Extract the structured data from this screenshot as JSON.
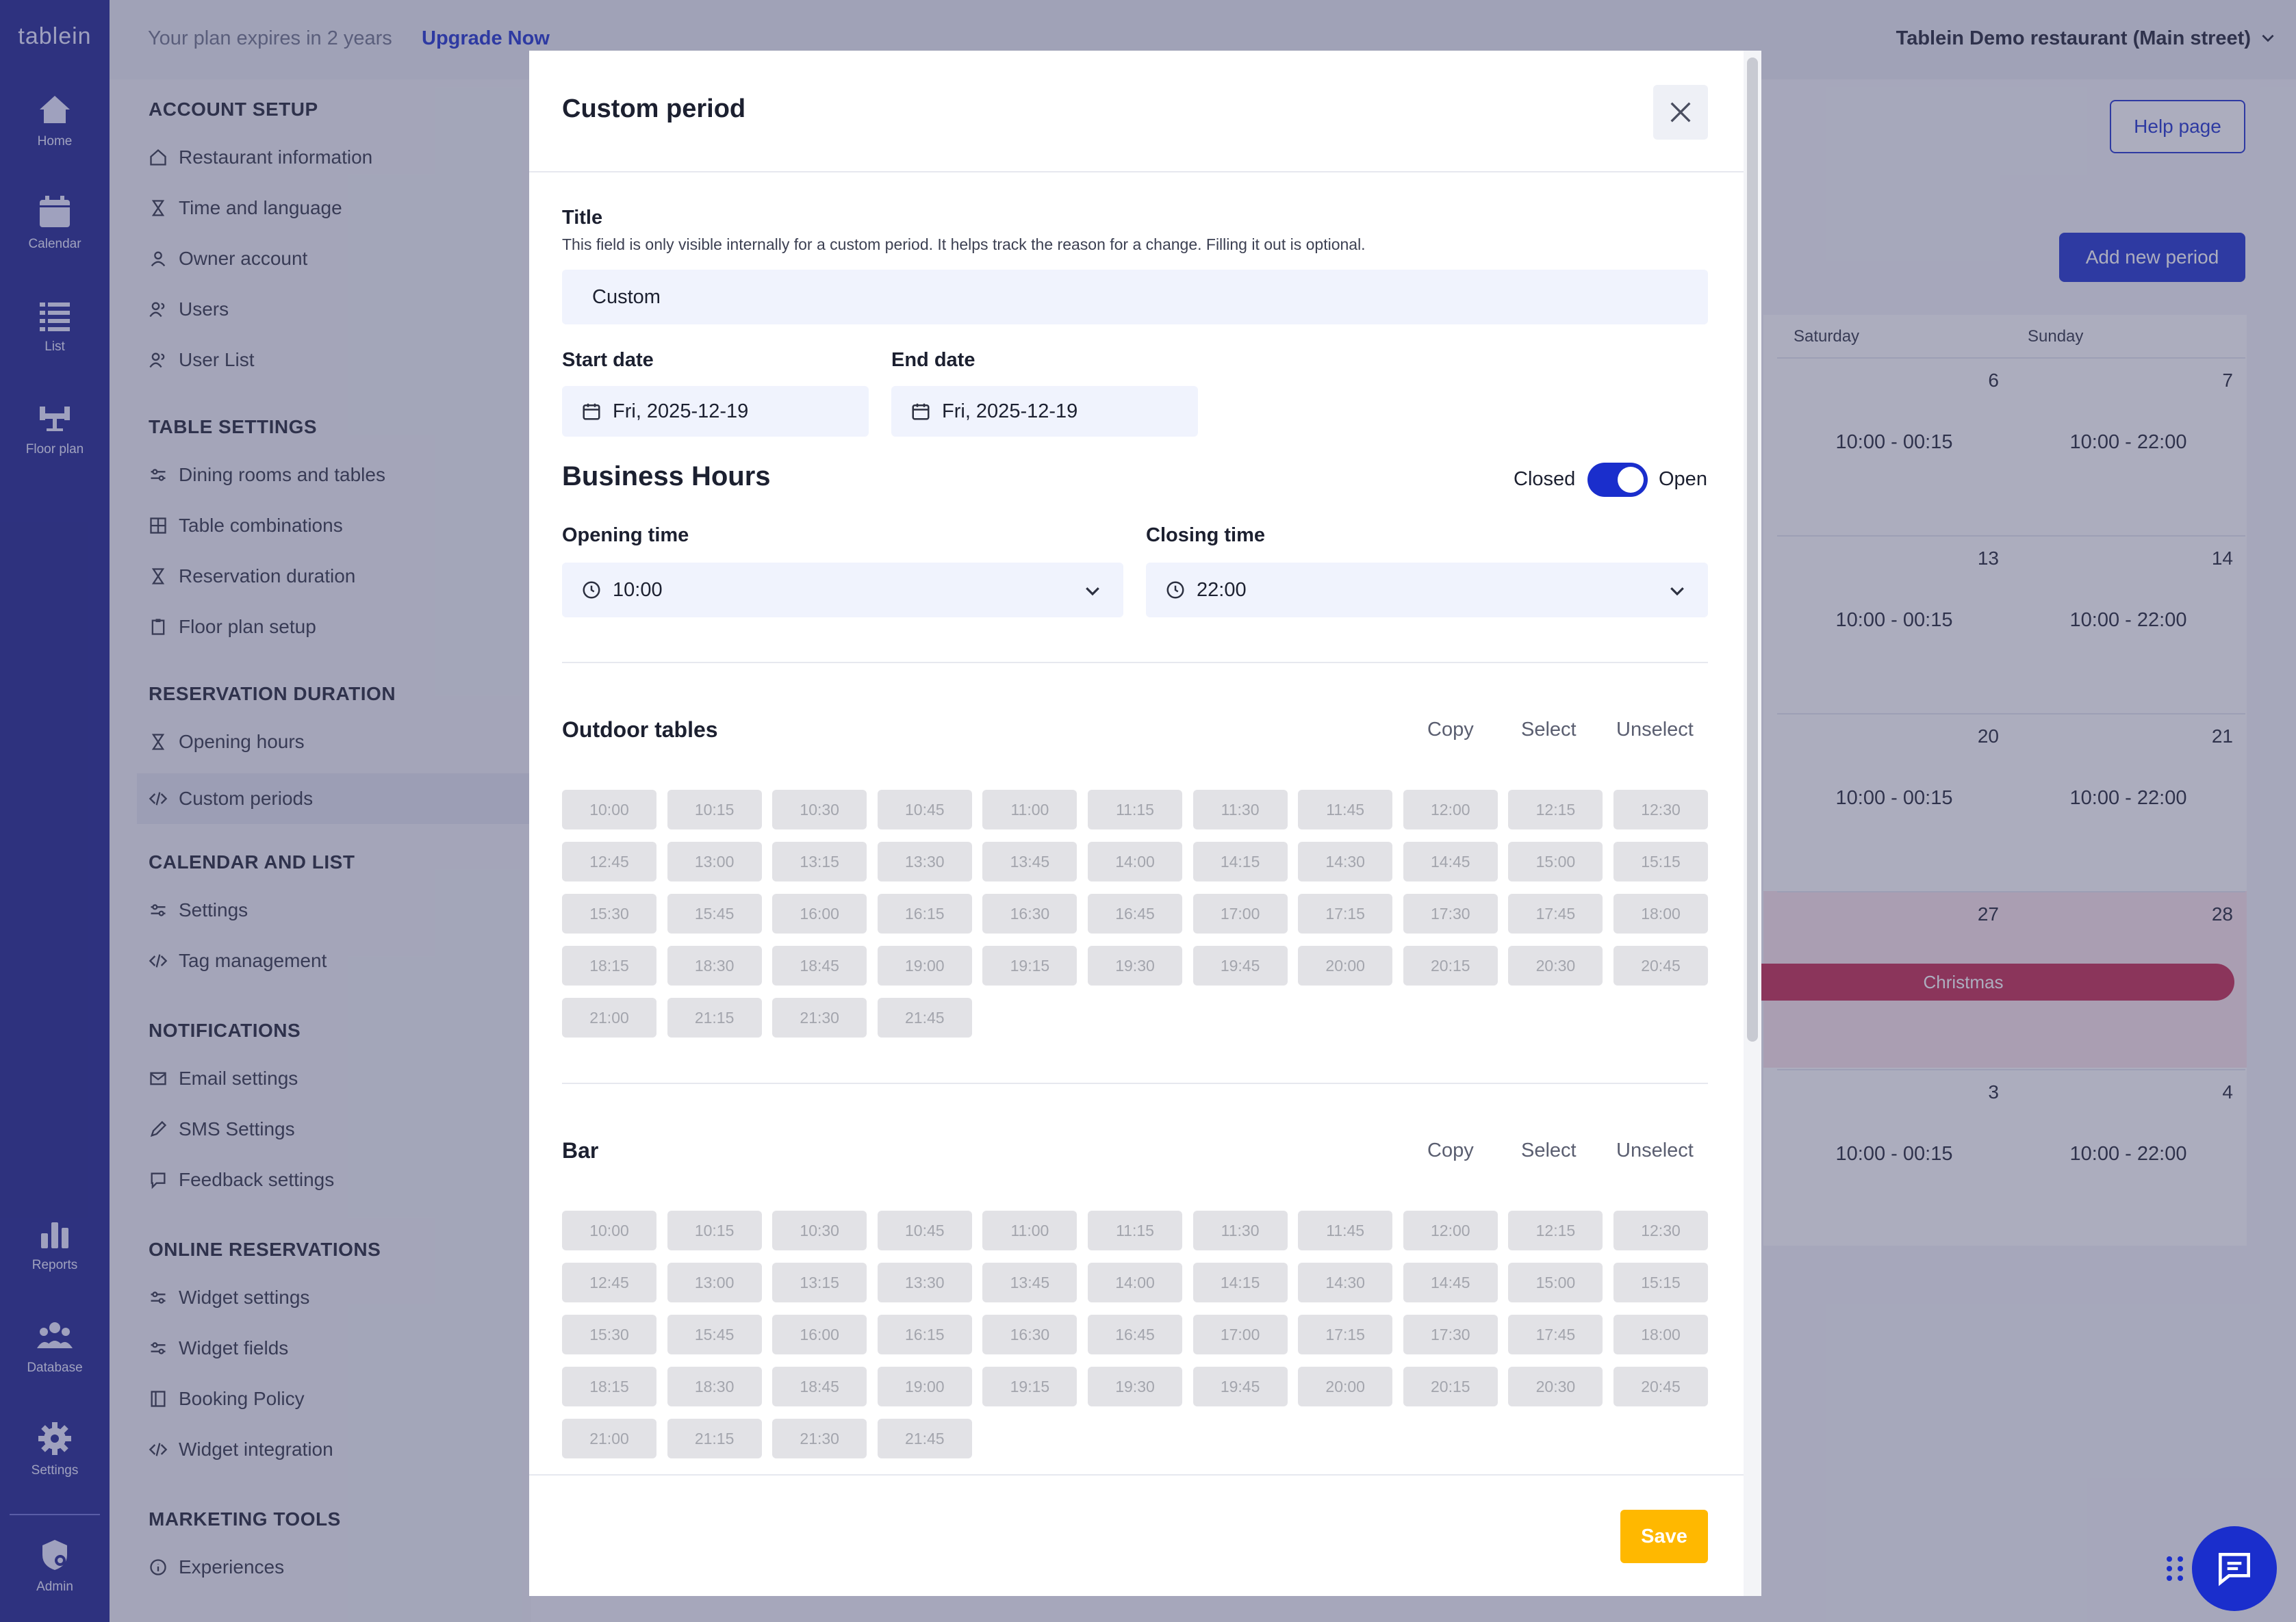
{
  "app": {
    "logo": "tablein"
  },
  "rail": {
    "top": [
      {
        "label": "Home",
        "icon": "home-icon"
      },
      {
        "label": "Calendar",
        "icon": "calendar-icon"
      },
      {
        "label": "List",
        "icon": "list-icon"
      },
      {
        "label": "Floor plan",
        "icon": "floor-plan-icon"
      }
    ],
    "bottom": [
      {
        "label": "Reports",
        "icon": "bar-chart-icon"
      },
      {
        "label": "Database",
        "icon": "users-group-icon"
      },
      {
        "label": "Settings",
        "icon": "gear-icon"
      },
      {
        "label": "Admin",
        "icon": "shield-gear-icon"
      }
    ]
  },
  "topbar": {
    "plan_text": "Your plan expires in 2 years",
    "upgrade_label": "Upgrade Now",
    "restaurant": "Tablein Demo restaurant (Main street)"
  },
  "menu": {
    "sections": [
      {
        "title": "ACCOUNT SETUP",
        "items": [
          "Restaurant information",
          "Time and language",
          "Owner account",
          "Users",
          "User List"
        ]
      },
      {
        "title": "TABLE SETTINGS",
        "items": [
          "Dining rooms and tables",
          "Table combinations",
          "Reservation duration",
          "Floor plan setup"
        ]
      },
      {
        "title": "RESERVATION DURATION",
        "items": [
          "Opening hours",
          "Custom periods"
        ]
      },
      {
        "title": "CALENDAR AND LIST",
        "items": [
          "Settings",
          "Tag management"
        ]
      },
      {
        "title": "NOTIFICATIONS",
        "items": [
          "Email settings",
          "SMS Settings",
          "Feedback settings"
        ]
      },
      {
        "title": "ONLINE RESERVATIONS",
        "items": [
          "Widget settings",
          "Widget fields",
          "Booking Policy",
          "Widget integration"
        ]
      },
      {
        "title": "MARKETING TOOLS",
        "items": [
          "Experiences"
        ]
      }
    ],
    "active_item": "Custom periods"
  },
  "content": {
    "help_label": "Help page",
    "add_label": "Add new period",
    "cal_headers": [
      "Saturday",
      "Sunday"
    ],
    "cal_rows": [
      {
        "sat_day": "6",
        "sun_day": "7",
        "sat_hours": "10:00 - 00:15",
        "sun_hours": "10:00 - 22:00"
      },
      {
        "sat_day": "13",
        "sun_day": "14",
        "sat_hours": "10:00 - 00:15",
        "sun_hours": "10:00 - 22:00"
      },
      {
        "sat_day": "20",
        "sun_day": "21",
        "sat_hours": "10:00 - 00:15",
        "sun_hours": "10:00 - 22:00"
      },
      {
        "sat_day": "27",
        "sun_day": "28",
        "sat_hours": "",
        "sun_hours": ""
      },
      {
        "sat_day": "3",
        "sun_day": "4",
        "sat_hours": "10:00 - 00:15",
        "sun_hours": "10:00 - 22:00"
      }
    ],
    "event_label": "Christmas"
  },
  "modal": {
    "title": "Custom period",
    "title_label": "Title",
    "title_help": "This field is only visible internally for a custom period. It helps track the reason for a change. Filling it out is optional.",
    "title_value": "Custom",
    "start_label": "Start date",
    "start_value": "Fri, 2025-12-19",
    "end_label": "End date",
    "end_value": "Fri, 2025-12-19",
    "business_hours": "Business Hours",
    "closed_label": "Closed",
    "open_label": "Open",
    "toggle_on": true,
    "opening_label": "Opening time",
    "opening_value": "10:00",
    "closing_label": "Closing time",
    "closing_value": "22:00",
    "sections": [
      {
        "name": "Outdoor tables",
        "copy": "Copy",
        "select": "Select",
        "unselect": "Unselect"
      },
      {
        "name": "Bar",
        "copy": "Copy",
        "select": "Select",
        "unselect": "Unselect"
      }
    ],
    "slots": [
      "10:00",
      "10:15",
      "10:30",
      "10:45",
      "11:00",
      "11:15",
      "11:30",
      "11:45",
      "12:00",
      "12:15",
      "12:30",
      "12:45",
      "13:00",
      "13:15",
      "13:30",
      "13:45",
      "14:00",
      "14:15",
      "14:30",
      "14:45",
      "15:00",
      "15:15",
      "15:30",
      "15:45",
      "16:00",
      "16:15",
      "16:30",
      "16:45",
      "17:00",
      "17:15",
      "17:30",
      "17:45",
      "18:00",
      "18:15",
      "18:30",
      "18:45",
      "19:00",
      "19:15",
      "19:30",
      "19:45",
      "20:00",
      "20:15",
      "20:30",
      "20:45",
      "21:00",
      "21:15",
      "21:30",
      "21:45"
    ],
    "save_label": "Save"
  },
  "colors": {
    "brand": "#1a2ecc",
    "rail": "#1a1f8c",
    "save": "#ffb800",
    "event": "#c4264b"
  }
}
